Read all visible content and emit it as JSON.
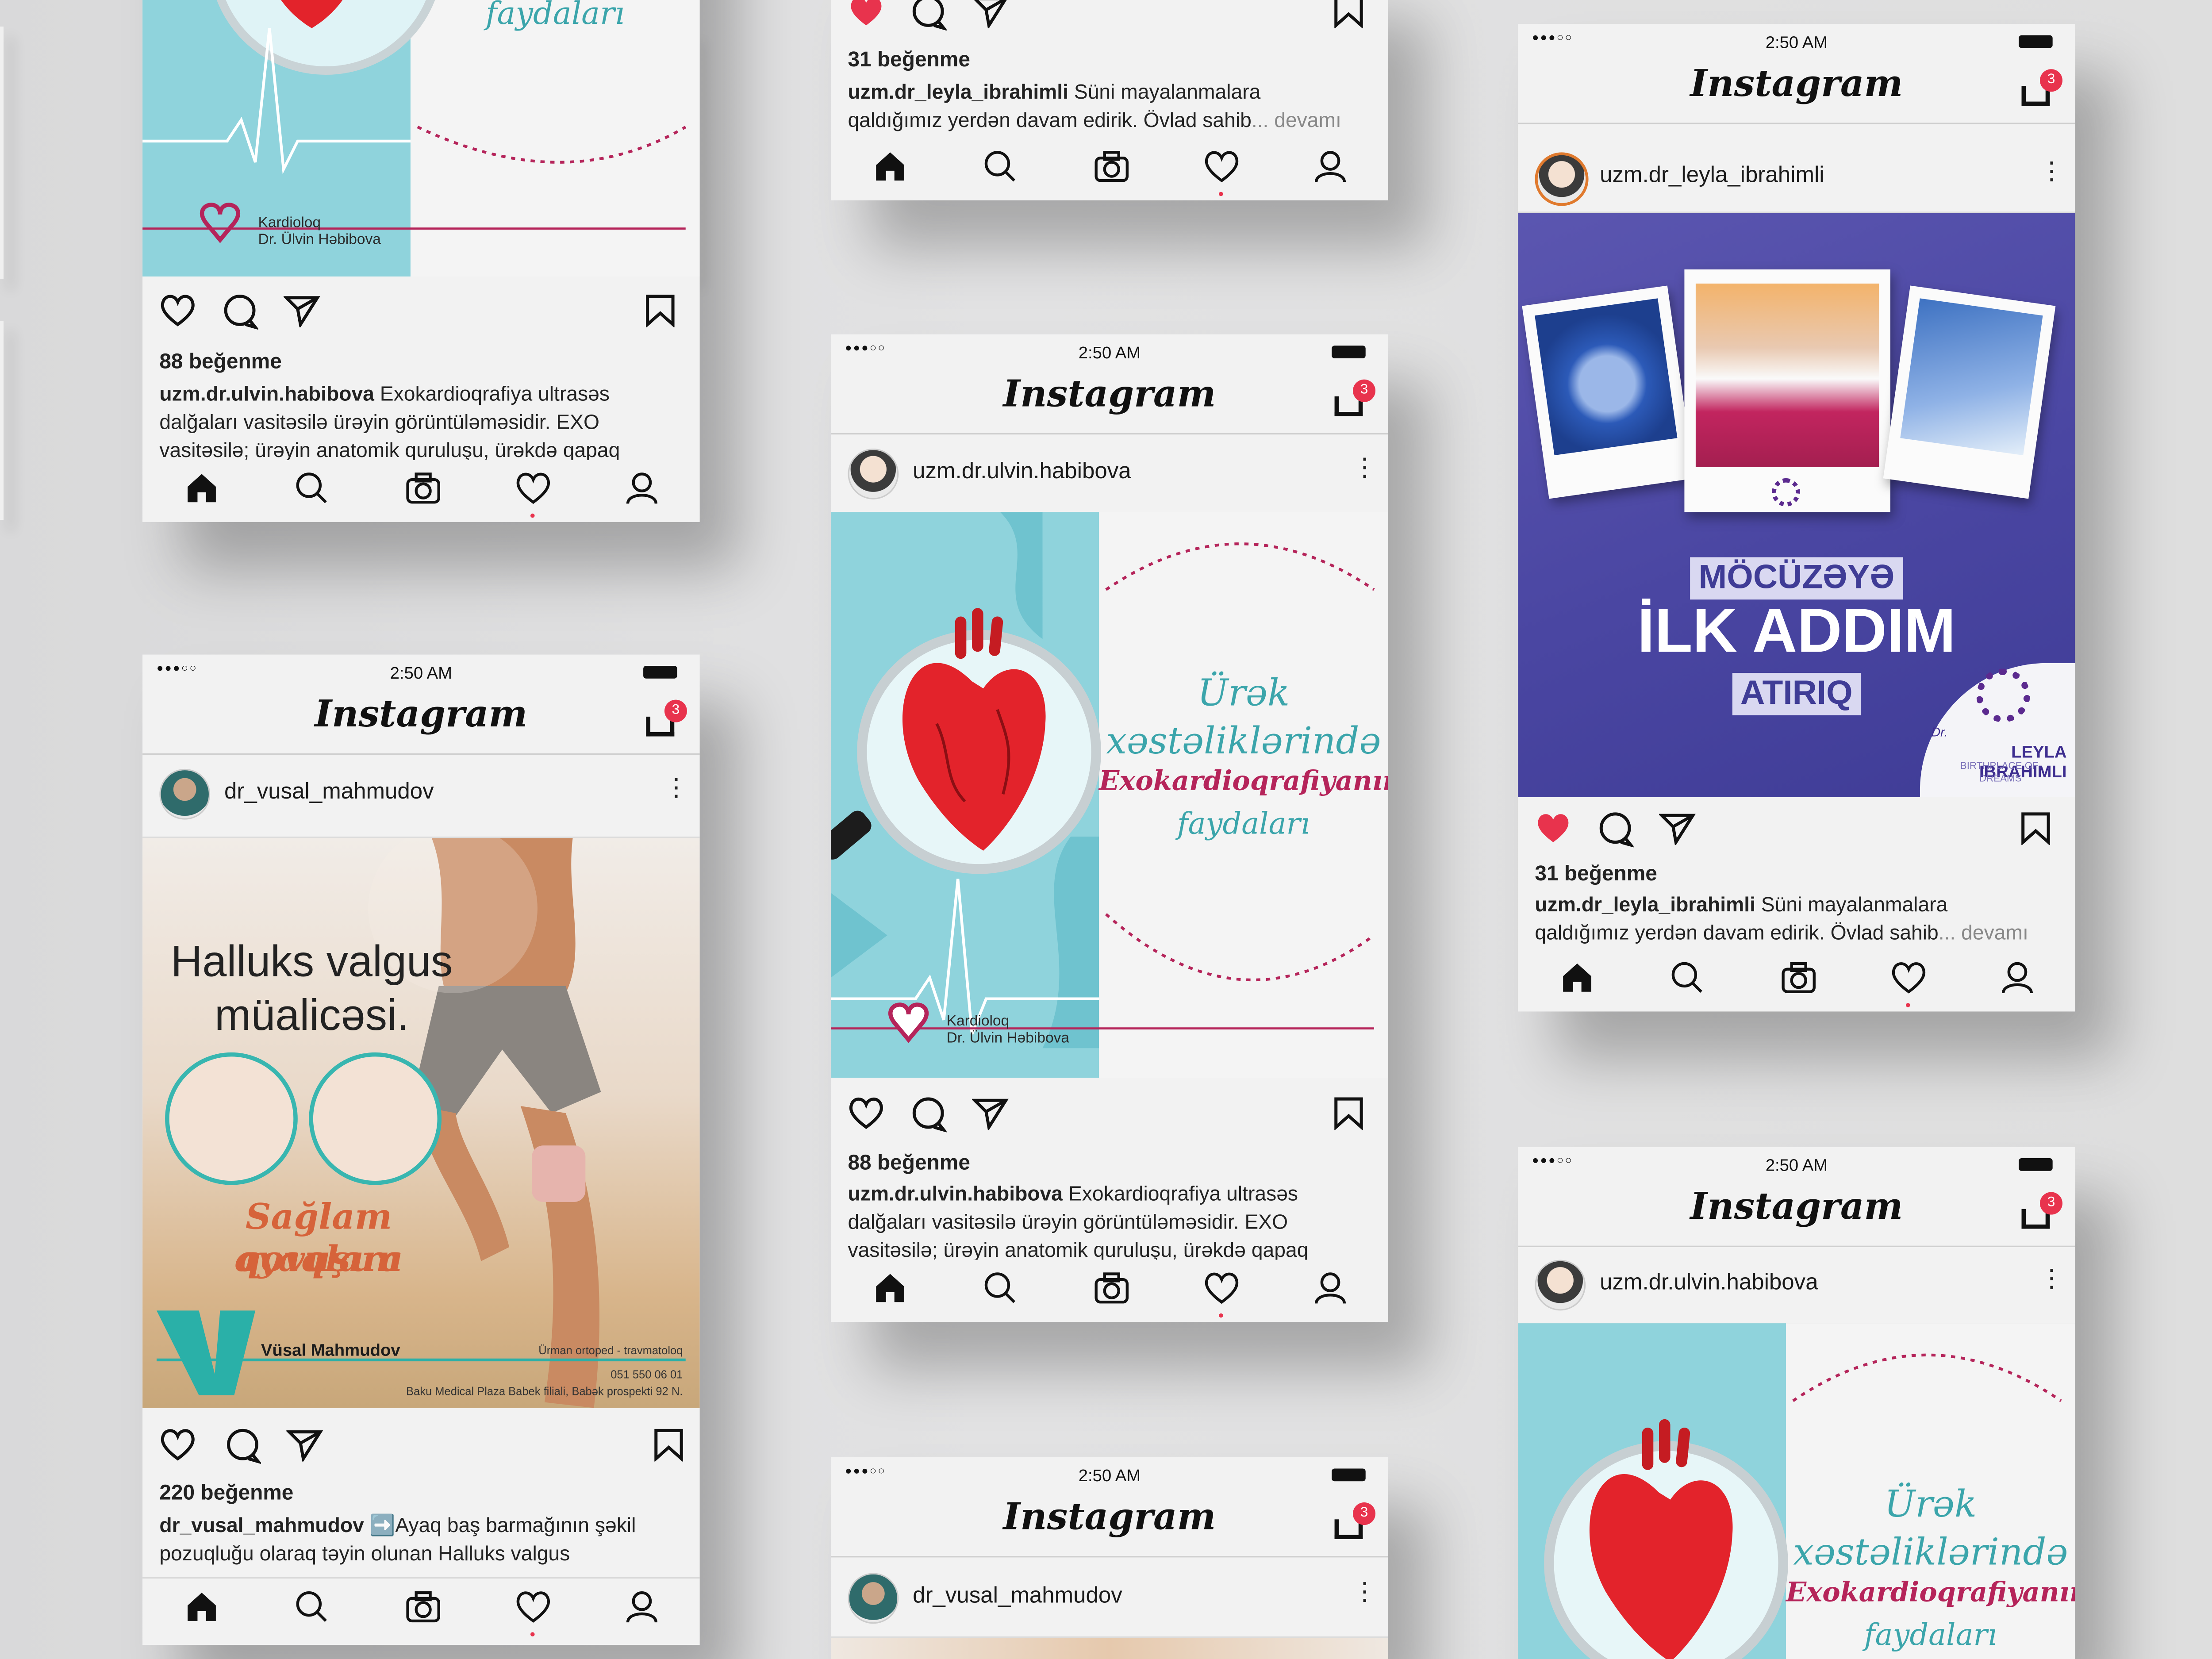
{
  "status": {
    "time": "2:50 AM",
    "signal": "●●●○○"
  },
  "app": {
    "title": "Instagram",
    "inbox_badge": "3"
  },
  "colors": {
    "notification": "#e8334d",
    "heart_teal": "#8fd3dc",
    "fertility_purple": "#4a46a2",
    "accent_magenta": "#b5245a"
  },
  "posts": {
    "ulvin": {
      "username": "uzm.dr.ulvin.habibova",
      "likes": "88 beğenme",
      "caption_line1": "Exokardioqrafiya ultrasəs",
      "caption_line2": "dalğaları vasitəsilə ürəyin görüntüləməsidir. EXO",
      "caption_line3": "vasitəsilə; ürəyin anatomik quruluşu, ürəkdə qapaq",
      "poster": {
        "line1": "Ürək",
        "line2": "xəstəliklərində",
        "line3": "Exokardioqrafiyanın",
        "line4": "faydaları",
        "sign1": "Kardioloq",
        "sign2": "Dr. Ülvin Həbibova"
      }
    },
    "leyla": {
      "username": "uzm.dr_leyla_ibrahimli",
      "likes": "31 beğenme",
      "caption_line1": "Süni mayalanmalara",
      "caption_line2": "qaldığımız yerdən davam edirik. Övlad sahib",
      "more": "... devamı",
      "poster": {
        "word1": "MÖCÜZƏYƏ",
        "word2": "İLK ADDIM",
        "word3": "ATIRIQ",
        "logo_prefix": "Dr.",
        "logo_name": "LEYLA IBRAHIMLI",
        "logo_tag1": "BIRTHPLACE OF",
        "logo_tag2": "DREAMS"
      }
    },
    "vusal": {
      "username": "dr_vusal_mahmudov",
      "likes": "220 beğenme",
      "caption_line1": "➡️Ayaq baş barmağının şəkil",
      "caption_line2": "pozuqluğu olaraq təyin olunan Halluks valgus",
      "poster": {
        "title1": "Halluks valgus",
        "title2": "müalicəsi.",
        "sub1": "Sağlam ayaqlara",
        "sub2": "qovuşun",
        "doctor": "Vüsal Mahmudov",
        "role": "Ürman ortoped - travmatoloq",
        "phone": "051 550 06 01",
        "address": "Baku Medical Plaza Babek filiali, Babək prospekti 92 N."
      }
    }
  }
}
